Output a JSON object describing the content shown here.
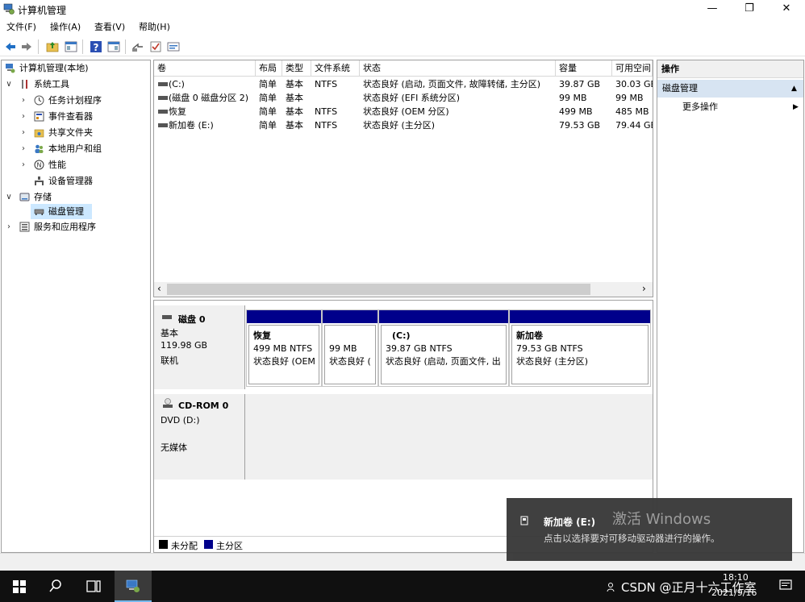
{
  "window": {
    "title": "计算机管理",
    "controls": {
      "minimize": "—",
      "maximize": "❐",
      "close": "✕"
    }
  },
  "menubar": [
    "文件(F)",
    "操作(A)",
    "查看(V)",
    "帮助(H)"
  ],
  "toolbar": {
    "icons": [
      "back-arrow-icon",
      "forward-arrow-icon",
      "up-folder-icon",
      "show-tree-icon",
      "help-icon",
      "properties-icon",
      "export-icon",
      "checklist-icon",
      "console-icon"
    ]
  },
  "tree": {
    "root": "计算机管理(本地)",
    "system_tools": "系统工具",
    "task_scheduler": "任务计划程序",
    "event_viewer": "事件查看器",
    "shared_folders": "共享文件夹",
    "local_users": "本地用户和组",
    "performance": "性能",
    "device_manager": "设备管理器",
    "storage": "存储",
    "disk_management": "磁盘管理",
    "services": "服务和应用程序"
  },
  "volume_list": {
    "columns": [
      "卷",
      "布局",
      "类型",
      "文件系统",
      "状态",
      "容量",
      "可用空间"
    ],
    "rows": [
      [
        "(C:)",
        "简单",
        "基本",
        "NTFS",
        "状态良好 (启动, 页面文件, 故障转储, 主分区)",
        "39.87 GB",
        "30.03 GB"
      ],
      [
        "(磁盘 0 磁盘分区 2)",
        "简单",
        "基本",
        "",
        "状态良好 (EFI 系统分区)",
        "99 MB",
        "99 MB"
      ],
      [
        "恢复",
        "简单",
        "基本",
        "NTFS",
        "状态良好 (OEM 分区)",
        "499 MB",
        "485 MB"
      ],
      [
        "新加卷 (E:)",
        "简单",
        "基本",
        "NTFS",
        "状态良好 (主分区)",
        "79.53 GB",
        "79.44 GB"
      ]
    ],
    "scroll_left": "‹",
    "scroll_right": "›"
  },
  "disks": [
    {
      "name": "磁盘 0",
      "type": "基本",
      "size": "119.98 GB",
      "status": "联机",
      "partitions": [
        {
          "name": "恢复",
          "size": "499 MB NTFS",
          "status": "状态良好 (OEM"
        },
        {
          "name": "",
          "size": "99 MB",
          "status": "状态良好 ("
        },
        {
          "name": "(C:)",
          "size": "39.87 GB NTFS",
          "status": "状态良好 (启动, 页面文件, 出"
        },
        {
          "name": "新加卷",
          "size": "79.53 GB NTFS",
          "status": "状态良好 (主分区)"
        }
      ]
    },
    {
      "name": "CD-ROM 0",
      "type": "DVD (D:)",
      "status": "无媒体"
    }
  ],
  "legend": {
    "unallocated": "未分配",
    "primary": "主分区"
  },
  "actions": {
    "header": "操作",
    "section": "磁盘管理",
    "more": "更多操作"
  },
  "toast": {
    "title": "新加卷 (E:)",
    "watermark": "激活 Windows",
    "body": "点击以选择要对可移动驱动器进行的操作。"
  },
  "taskbar": {
    "tray_text": "CSDN @正月十六工作室",
    "time": "18:10",
    "date": "2021/9/16"
  },
  "colors": {
    "primary_partition": "#00008b",
    "unallocated": "#000000",
    "selection": "#cce8ff",
    "actions_section": "#d7e4f2"
  }
}
